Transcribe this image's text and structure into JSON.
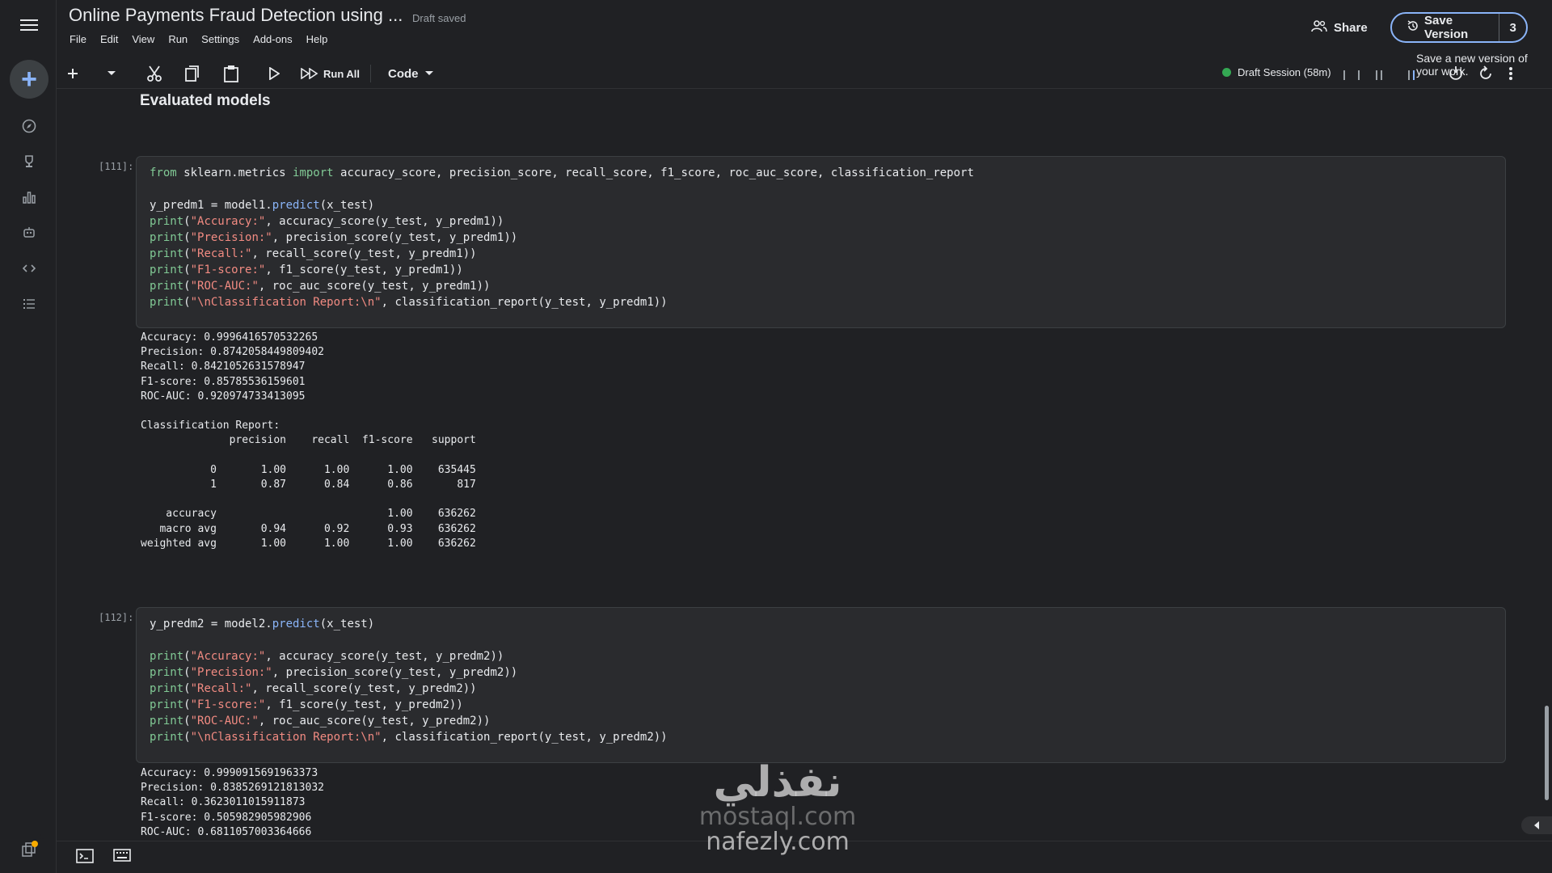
{
  "app": {
    "title": "Online Payments Fraud Detection using ...",
    "draft_status": "Draft saved",
    "menu": [
      "File",
      "Edit",
      "View",
      "Run",
      "Settings",
      "Add-ons",
      "Help"
    ],
    "share_label": "Share",
    "save_version_label": "Save Version",
    "version_count": "3",
    "tooltip": "Save a new version of your work."
  },
  "toolbar": {
    "run_all_label": "Run All",
    "cell_type": "Code",
    "session_label": "Draft Session (58m)",
    "icons": [
      "add-icon",
      "chevron-down-icon",
      "cut-icon",
      "copy-icon",
      "paste-icon",
      "run-icon",
      "run-all-icon",
      "power-icon",
      "refresh-icon",
      "more-icon"
    ]
  },
  "sidebar": {
    "icons": [
      "menu-icon",
      "create-icon",
      "compass-icon",
      "trophy-icon",
      "chart-icon",
      "robot-icon",
      "code-icon",
      "list-icon",
      "copy-stack-icon"
    ],
    "notification_badge": "1"
  },
  "notebook": {
    "section_heading": "Evaluated models",
    "cells": [
      {
        "number": "[111]:",
        "code": [
          "from sklearn.metrics import accuracy_score, precision_score, recall_score, f1_score, roc_auc_score, classification_report",
          "",
          "y_predm1 = model1.predict(x_test)",
          "print(\"Accuracy:\", accuracy_score(y_test, y_predm1))",
          "print(\"Precision:\", precision_score(y_test, y_predm1))",
          "print(\"Recall:\", recall_score(y_test, y_predm1))",
          "print(\"F1-score:\", f1_score(y_test, y_predm1))",
          "print(\"ROC-AUC:\", roc_auc_score(y_test, y_predm1))",
          "print(\"\\nClassification Report:\\n\", classification_report(y_test, y_predm1))"
        ],
        "output": "Accuracy: 0.9996416570532265\nPrecision: 0.8742058449809402\nRecall: 0.8421052631578947\nF1-score: 0.85785536159601\nROC-AUC: 0.920974733413095\n\nClassification Report:\n              precision    recall  f1-score   support\n\n           0       1.00      1.00      1.00    635445\n           1       0.87      0.84      0.86       817\n\n    accuracy                           1.00    636262\n   macro avg       0.94      0.92      0.93    636262\nweighted avg       1.00      1.00      1.00    636262"
      },
      {
        "number": "[112]:",
        "code": [
          "y_predm2 = model2.predict(x_test)",
          "",
          "print(\"Accuracy:\", accuracy_score(y_test, y_predm2))",
          "print(\"Precision:\", precision_score(y_test, y_predm2))",
          "print(\"Recall:\", recall_score(y_test, y_predm2))",
          "print(\"F1-score:\", f1_score(y_test, y_predm2))",
          "print(\"ROC-AUC:\", roc_auc_score(y_test, y_predm2))",
          "print(\"\\nClassification Report:\\n\", classification_report(y_test, y_predm2))"
        ],
        "output": "Accuracy: 0.9990915691963373\nPrecision: 0.8385269121813032\nRecall: 0.3623011015911873\nF1-score: 0.505982905982906\nROC-AUC: 0.6811057003364666"
      }
    ]
  },
  "watermark": {
    "arabic": "نفذلي",
    "line1": "mostaql.com",
    "line2": "nafezly.com"
  },
  "colors": {
    "background": "#202124",
    "cell_background": "#2a2b2e",
    "accent": "#8ab4f8",
    "keyword": "#81c995",
    "string": "#f28b82",
    "session_dot": "#34a853"
  }
}
